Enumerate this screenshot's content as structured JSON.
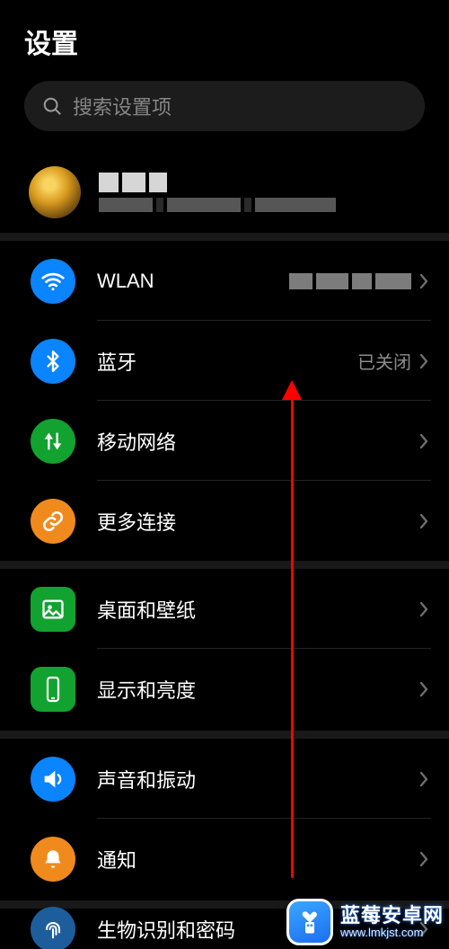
{
  "title": "设置",
  "search": {
    "placeholder": "搜索设置项"
  },
  "account": {
    "name_redacted": true,
    "sub_redacted": true
  },
  "groups": {
    "network": {
      "wlan": {
        "label": "WLAN",
        "value_redacted": true,
        "icon": "wifi",
        "color": "blue"
      },
      "bt": {
        "label": "蓝牙",
        "value": "已关闭",
        "icon": "bluetooth",
        "color": "blue"
      },
      "mobile": {
        "label": "移动网络",
        "icon": "data-arrows",
        "color": "green"
      },
      "more": {
        "label": "更多连接",
        "icon": "link",
        "color": "orange"
      }
    },
    "display": {
      "home": {
        "label": "桌面和壁纸",
        "icon": "picture",
        "color": "green"
      },
      "bright": {
        "label": "显示和亮度",
        "icon": "phone-light",
        "color": "green"
      }
    },
    "sound": {
      "sound": {
        "label": "声音和振动",
        "icon": "speaker",
        "color": "blue"
      },
      "notif": {
        "label": "通知",
        "icon": "bell",
        "color": "orange"
      }
    },
    "bio": {
      "bio": {
        "label": "生物识别和密码",
        "icon": "fingerprint",
        "color": "darkblu"
      }
    }
  },
  "watermark": {
    "title": "蓝莓安卓网",
    "url": "www.lmkjst.com"
  }
}
